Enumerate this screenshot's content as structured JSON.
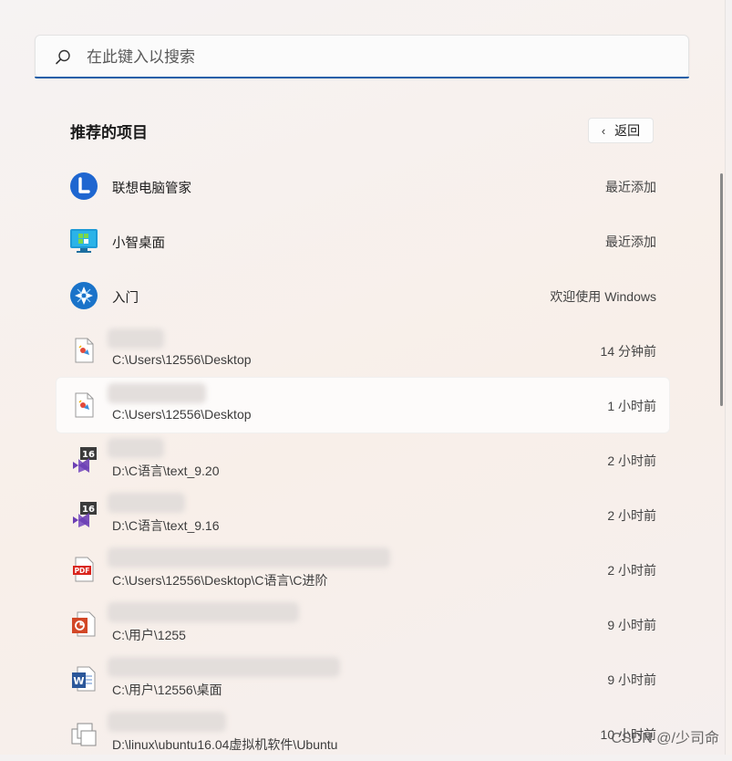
{
  "search": {
    "placeholder": "在此键入以搜索",
    "value": ""
  },
  "section": {
    "title": "推荐的项目",
    "back_label": "返回"
  },
  "items": [
    {
      "name": "联想电脑管家",
      "path": "",
      "meta": "最近添加",
      "icon": "lenovo-pc-manager-icon"
    },
    {
      "name": "小智桌面",
      "path": "",
      "meta": "最近添加",
      "icon": "desktop-app-icon"
    },
    {
      "name": "入门",
      "path": "",
      "meta": "欢迎使用 Windows",
      "icon": "get-started-icon"
    },
    {
      "name": "",
      "path": "C:\\Users\\12556\\Desktop",
      "meta": "14 分钟前",
      "icon": "image-file-icon"
    },
    {
      "name": "",
      "path": "C:\\Users\\12556\\Desktop",
      "meta": "1 小时前",
      "icon": "image-file-icon"
    },
    {
      "name": "",
      "path": "D:\\C语言\\text_9.20",
      "meta": "2 小时前",
      "icon": "visual-studio-icon"
    },
    {
      "name": "",
      "path": "D:\\C语言\\text_9.16",
      "meta": "2 小时前",
      "icon": "visual-studio-icon"
    },
    {
      "name": "",
      "path": "C:\\Users\\12556\\Desktop\\C语言\\C进阶",
      "meta": "2 小时前",
      "icon": "pdf-file-icon"
    },
    {
      "name": "",
      "path": "C:\\用户\\1255",
      "meta": "9 小时前",
      "icon": "powerpoint-file-icon"
    },
    {
      "name": "",
      "path": "C:\\用户\\12556\\桌面",
      "meta": "9 小时前",
      "icon": "word-file-icon"
    },
    {
      "name": "",
      "path": "D:\\linux\\ubuntu16.04虚拟机软件\\Ubuntu",
      "meta": "10 小时前",
      "icon": "virtual-machine-file-icon"
    }
  ],
  "watermark": "CSDN @/少司命",
  "colors": {
    "accent": "#1f5fa8",
    "lenovo_blue": "#1e66d0",
    "vs_purple": "#6c3fb4",
    "pdf_red": "#d9251d",
    "ppt_orange": "#d24726",
    "word_blue": "#2b579a"
  }
}
